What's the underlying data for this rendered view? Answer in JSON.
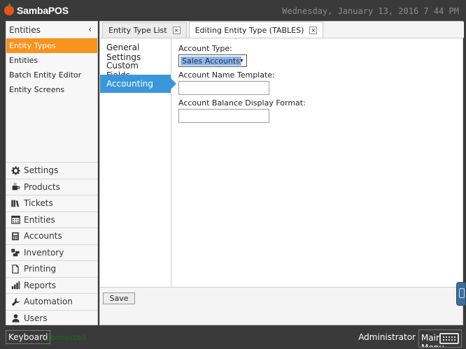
{
  "app": {
    "name": "SambaPOS",
    "datetime": "Wednesday, January 13, 2016 7 44 PM"
  },
  "sidebar": {
    "header": "Entities",
    "collapse_glyph": "‹",
    "items": [
      {
        "label": "Entity Types",
        "active": true
      },
      {
        "label": "Entities"
      },
      {
        "label": "Batch Entity Editor"
      },
      {
        "label": "Entity Screens"
      }
    ],
    "nav": [
      {
        "label": "Settings",
        "icon": "gear-icon"
      },
      {
        "label": "Products",
        "icon": "coffee-icon"
      },
      {
        "label": "Tickets",
        "icon": "tickets-icon"
      },
      {
        "label": "Entities",
        "icon": "calendar-icon"
      },
      {
        "label": "Accounts",
        "icon": "calculator-icon"
      },
      {
        "label": "Inventory",
        "icon": "inventory-icon"
      },
      {
        "label": "Printing",
        "icon": "document-icon"
      },
      {
        "label": "Reports",
        "icon": "bar-chart-icon"
      },
      {
        "label": "Automation",
        "icon": "wrench-icon"
      },
      {
        "label": "Users",
        "icon": "user-icon"
      }
    ]
  },
  "tabs": [
    {
      "label": "Entity Type List",
      "active": false,
      "close": "×"
    },
    {
      "label": "Editing Entity Type (TABLES)",
      "active": true,
      "close": "×"
    }
  ],
  "subnav": [
    {
      "label": "General Settings"
    },
    {
      "label": "Custom Fields"
    },
    {
      "label": "Accounting",
      "active": true
    }
  ],
  "form": {
    "account_type_label": "Account Type:",
    "account_type_value": "Sales Accounts",
    "account_name_template_label": "Account Name Template:",
    "account_name_template_value": "",
    "balance_format_label": "Account Balance Display Format:",
    "balance_format_value": ""
  },
  "actions": {
    "save_label": "Save"
  },
  "footer": {
    "keyboard_label": "Keyboard",
    "connection_status": "Connected",
    "user": "Administrator",
    "main_menu_label": "Main Menu"
  },
  "colors": {
    "accent_orange": "#f7931e",
    "accent_blue": "#3b97d9",
    "connected_green": "#1d6b1d",
    "chrome": "#3a3a3a"
  }
}
